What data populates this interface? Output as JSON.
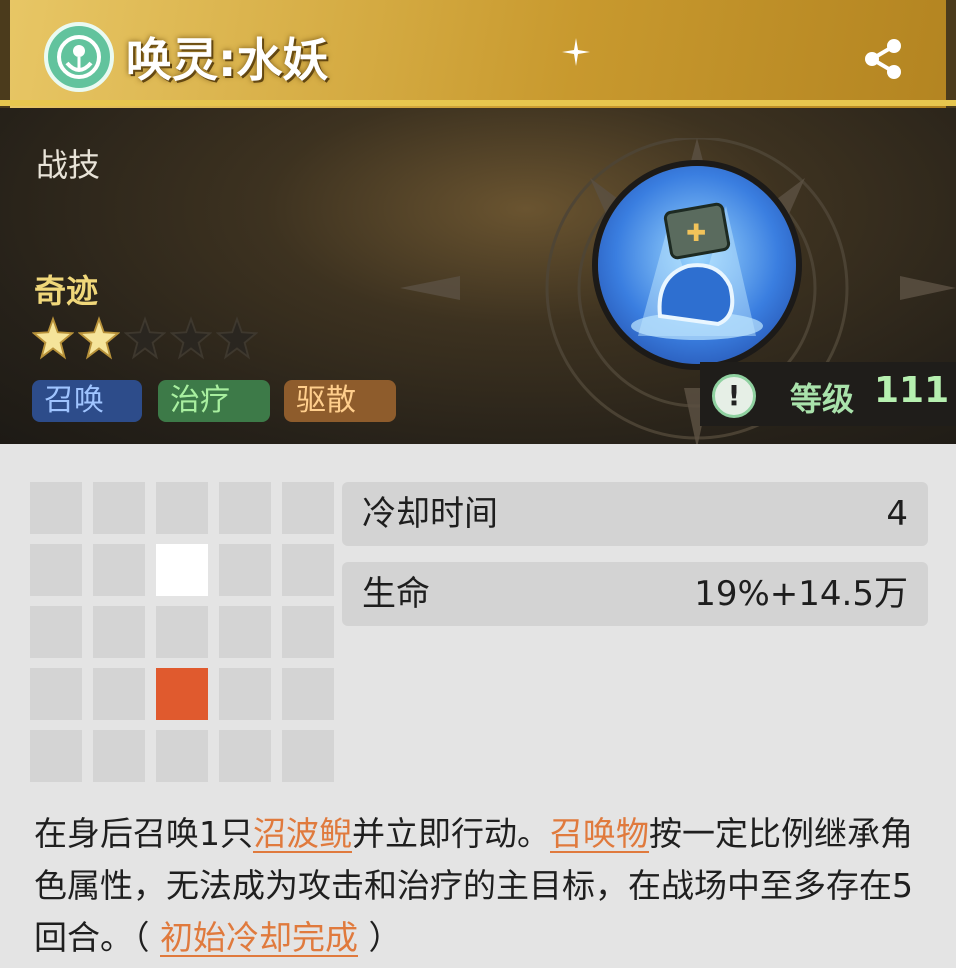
{
  "header": {
    "title": "唤灵:水妖",
    "app_icon": "summon-emblem-icon",
    "share_icon": "share-icon"
  },
  "skill": {
    "type_label": "战技",
    "rank_label": "奇迹",
    "stars_total": 5,
    "stars_filled": 2,
    "tags": [
      "召唤",
      "治疗",
      "驱散"
    ],
    "level_label": "等级",
    "level_value": "111"
  },
  "stats": [
    {
      "label": "冷却时间",
      "value": "4"
    },
    {
      "label": "生命",
      "value": "19%+14.5万"
    }
  ],
  "description": {
    "p1": "在身后召唤1只",
    "kw1": "沼波鲵",
    "p2": "并立即行动。",
    "kw2": "召唤物",
    "p3": "按一定比例继承角色属性，无法成为攻击和治疗的主目标，在战场中至多存在5回合。（ ",
    "kw3": "初始冷却完成",
    "p4": " ）"
  },
  "colors": {
    "accent_gold": "#e7c64e",
    "keyword": "#e07a3d",
    "grid_self": "#ffffff",
    "grid_target": "#e05a2e"
  }
}
